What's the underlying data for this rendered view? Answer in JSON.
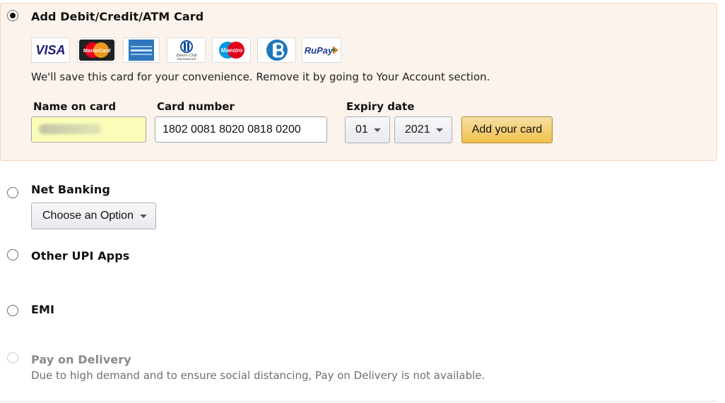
{
  "card": {
    "title": "Add Debit/Credit/ATM Card",
    "note": "We'll save this card for your convenience. Remove it by going to Your Account section.",
    "logos": {
      "visa": "VISA",
      "mastercard": "MasterCard",
      "amex": "AMERICAN EXPRESS",
      "diners": "Diners Club International",
      "maestro": "Maestro",
      "bajaj": "B",
      "rupay": "RuPay"
    },
    "name_label": "Name on card",
    "number_label": "Card number",
    "number_value": "1802 0081 8020 0818 0200",
    "expiry_label": "Expiry date",
    "expiry_month": "01",
    "expiry_year": "2021",
    "add_button": "Add your card"
  },
  "net_banking": {
    "title": "Net Banking",
    "select_value": "Choose an Option"
  },
  "upi": {
    "title": "Other UPI Apps"
  },
  "emi": {
    "title": "EMI"
  },
  "pod": {
    "title": "Pay on Delivery",
    "note": "Due to high demand and to ensure social distancing, Pay on Delivery is not available."
  },
  "colors": {
    "section_bg": "#fcf3ec",
    "button_yellow": "#f0c14b",
    "autofill_bg": "#fafdb8"
  }
}
